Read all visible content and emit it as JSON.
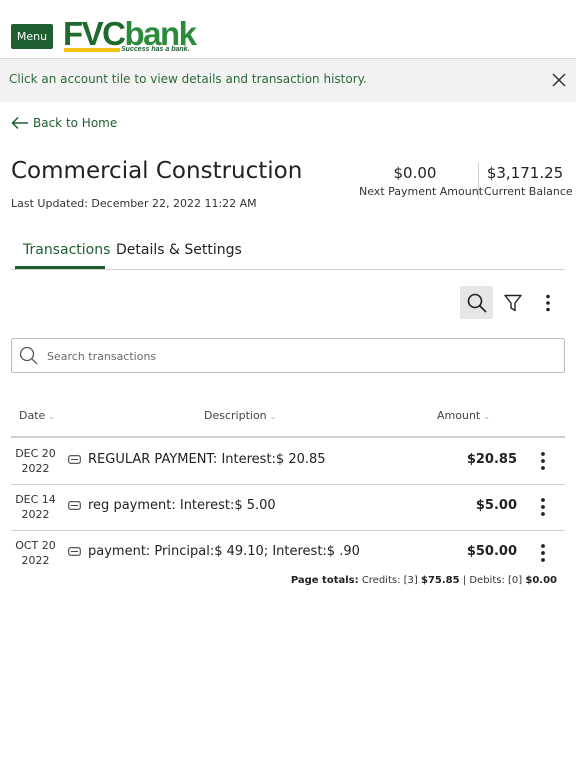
{
  "header": {
    "menu_label": "Menu",
    "logo": {
      "fvc": "FVC",
      "bank": "bank",
      "tagline": "Success has a bank."
    }
  },
  "banner": {
    "text": "Click an account tile to view details and transaction history."
  },
  "nav": {
    "back_label": "Back to Home"
  },
  "account": {
    "title": "Commercial Construction",
    "last_updated": "Last Updated: December 22, 2022 11:22 AM",
    "next_payment_amount": "$0.00",
    "next_payment_label": "Next Payment Amount",
    "current_balance": "$3,171.25",
    "current_balance_label": "Current Balance"
  },
  "tabs": [
    {
      "label": "Transactions",
      "active": true
    },
    {
      "label": "Details & Settings",
      "active": false
    }
  ],
  "toolbar": {
    "search_icon": "search-icon",
    "filter_icon": "filter-icon",
    "more_icon": "more-vertical-icon"
  },
  "search": {
    "placeholder": "Search transactions",
    "value": ""
  },
  "table": {
    "columns": [
      "Date",
      "Description",
      "Amount"
    ],
    "rows": [
      {
        "month_day": "DEC 20",
        "year": "2022",
        "description": "REGULAR PAYMENT: Interest:$ 20.85",
        "amount": "$20.85"
      },
      {
        "month_day": "DEC 14",
        "year": "2022",
        "description": "reg payment: Interest:$ 5.00",
        "amount": "$5.00"
      },
      {
        "month_day": "OCT 20",
        "year": "2022",
        "description": "payment: Principal:$ 49.10; Interest:$ .90",
        "amount": "$50.00"
      }
    ]
  },
  "totals": {
    "label": "Page totals:",
    "credits_label": "Credits: [3]",
    "credits_amount": "$75.85",
    "separator": "|",
    "debits_label": "Debits: [0]",
    "debits_amount": "$0.00"
  },
  "colors": {
    "brand_green": "#1f5e2f",
    "logo_yellow": "#f5c316",
    "banner_bg": "#f2f2f2"
  }
}
